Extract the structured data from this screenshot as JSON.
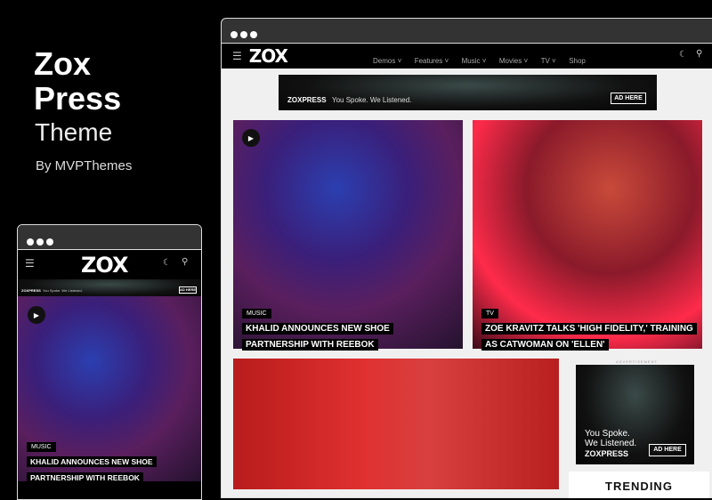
{
  "hero": {
    "title_line1": "Zox",
    "title_line2": "Press",
    "subtitle": "Theme",
    "byline": "By MVPThemes"
  },
  "desktop": {
    "logo": "ZOX",
    "menu": [
      "Demos",
      "Features",
      "Music",
      "Movies",
      "TV",
      "Shop"
    ],
    "menu_chevrons": [
      true,
      true,
      true,
      true,
      true,
      false
    ],
    "banner": {
      "brand": "ZOXPRESS",
      "tagline": "You Spoke. We Listened.",
      "cta": "AD HERE"
    },
    "feature1": {
      "category": "Music",
      "title": "Khalid Announces New Shoe Partnership With Reebok"
    },
    "feature2": {
      "category": "TV",
      "title": "Zoe Kravitz Talks 'High Fidelity,' Training as Catwoman on 'Ellen'"
    },
    "sidebar_ad": {
      "label": "Advertisement",
      "line1": "You Spoke.",
      "line2": "We Listened.",
      "brand": "ZOXPRESS",
      "cta": "AD HERE"
    },
    "trending": "TRENDING"
  },
  "mobile": {
    "logo": "ZOX",
    "banner": {
      "brand": "ZOXPRESS",
      "tagline": "You Spoke. We Listened.",
      "cta": "AD HERE"
    },
    "feature": {
      "category": "Music",
      "title": "Khalid Announces New Shoe Partnership With Reebok"
    }
  },
  "colors": {
    "background": "#000000",
    "content_bg": "#f0f0f0",
    "titlebar": "#333333"
  }
}
